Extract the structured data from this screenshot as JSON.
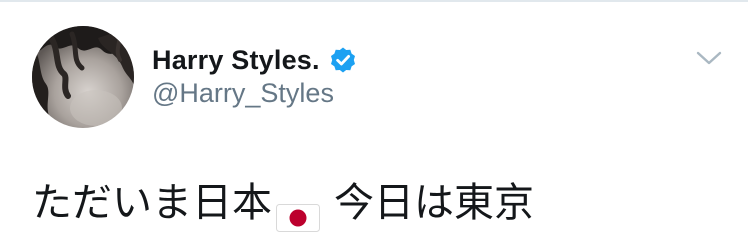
{
  "tweet": {
    "display_name": "Harry Styles.",
    "handle": "@Harry_Styles",
    "text_before_flag": "ただいま日本",
    "text_after_flag": "今日は東京"
  },
  "icons": {
    "verified": "verified-badge-icon",
    "caret": "chevron-down-icon",
    "flag": "flag-japan-icon"
  },
  "colors": {
    "text_primary": "#14171a",
    "text_secondary": "#657786",
    "verified_blue": "#1da1f2",
    "caret_gray": "#aab8c2",
    "flag_red": "#bc002d"
  }
}
